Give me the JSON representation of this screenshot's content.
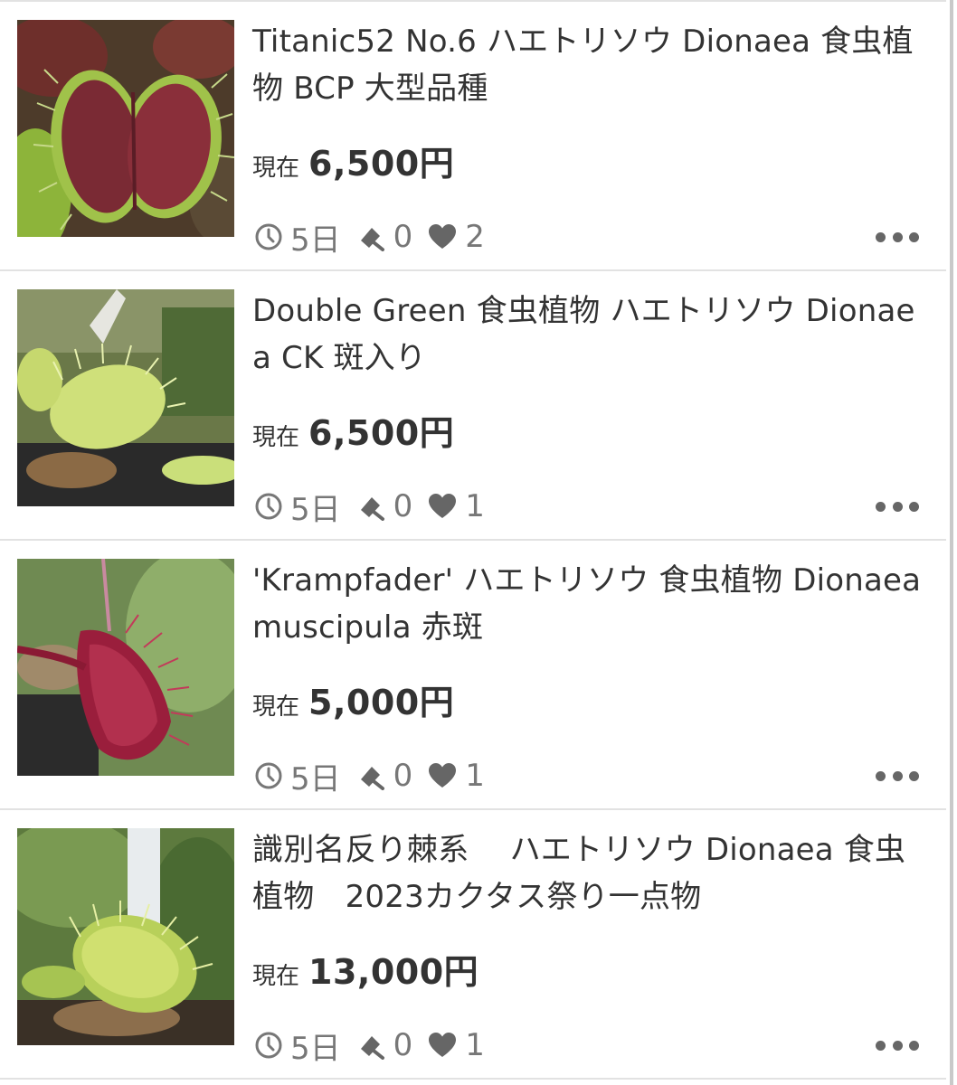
{
  "listings": [
    {
      "title": "Titanic52 No.6 ハエトリソウ Dionaea 食虫植物 BCP 大型品種",
      "price_label": "現在",
      "price": "6,500円",
      "time_left": "5日",
      "bids": "0",
      "watchers": "2",
      "thumb_style": "red-trap"
    },
    {
      "title": "Double Green 食虫植物 ハエトリソウ Dionaea CK 斑入り",
      "price_label": "現在",
      "price": "6,500円",
      "time_left": "5日",
      "bids": "0",
      "watchers": "1",
      "thumb_style": "green-trap"
    },
    {
      "title": "'Krampfader' ハエトリソウ 食虫植物 Dionaea muscipula 赤斑",
      "price_label": "現在",
      "price": "5,000円",
      "time_left": "5日",
      "bids": "0",
      "watchers": "1",
      "thumb_style": "red-side-trap"
    },
    {
      "title": "識別名反り棘系　 ハエトリソウ Dionaea 食虫植物　2023カクタス祭り一点物",
      "price_label": "現在",
      "price": "13,000円",
      "time_left": "5日",
      "bids": "0",
      "watchers": "1",
      "thumb_style": "yellow-trap"
    }
  ],
  "icons": {
    "time": "clock-icon",
    "bids": "gavel-icon",
    "watch": "heart-icon",
    "more": "more-dots-icon"
  },
  "colors": {
    "text": "#333333",
    "meta": "#777777",
    "divider": "#e2e2e2"
  }
}
